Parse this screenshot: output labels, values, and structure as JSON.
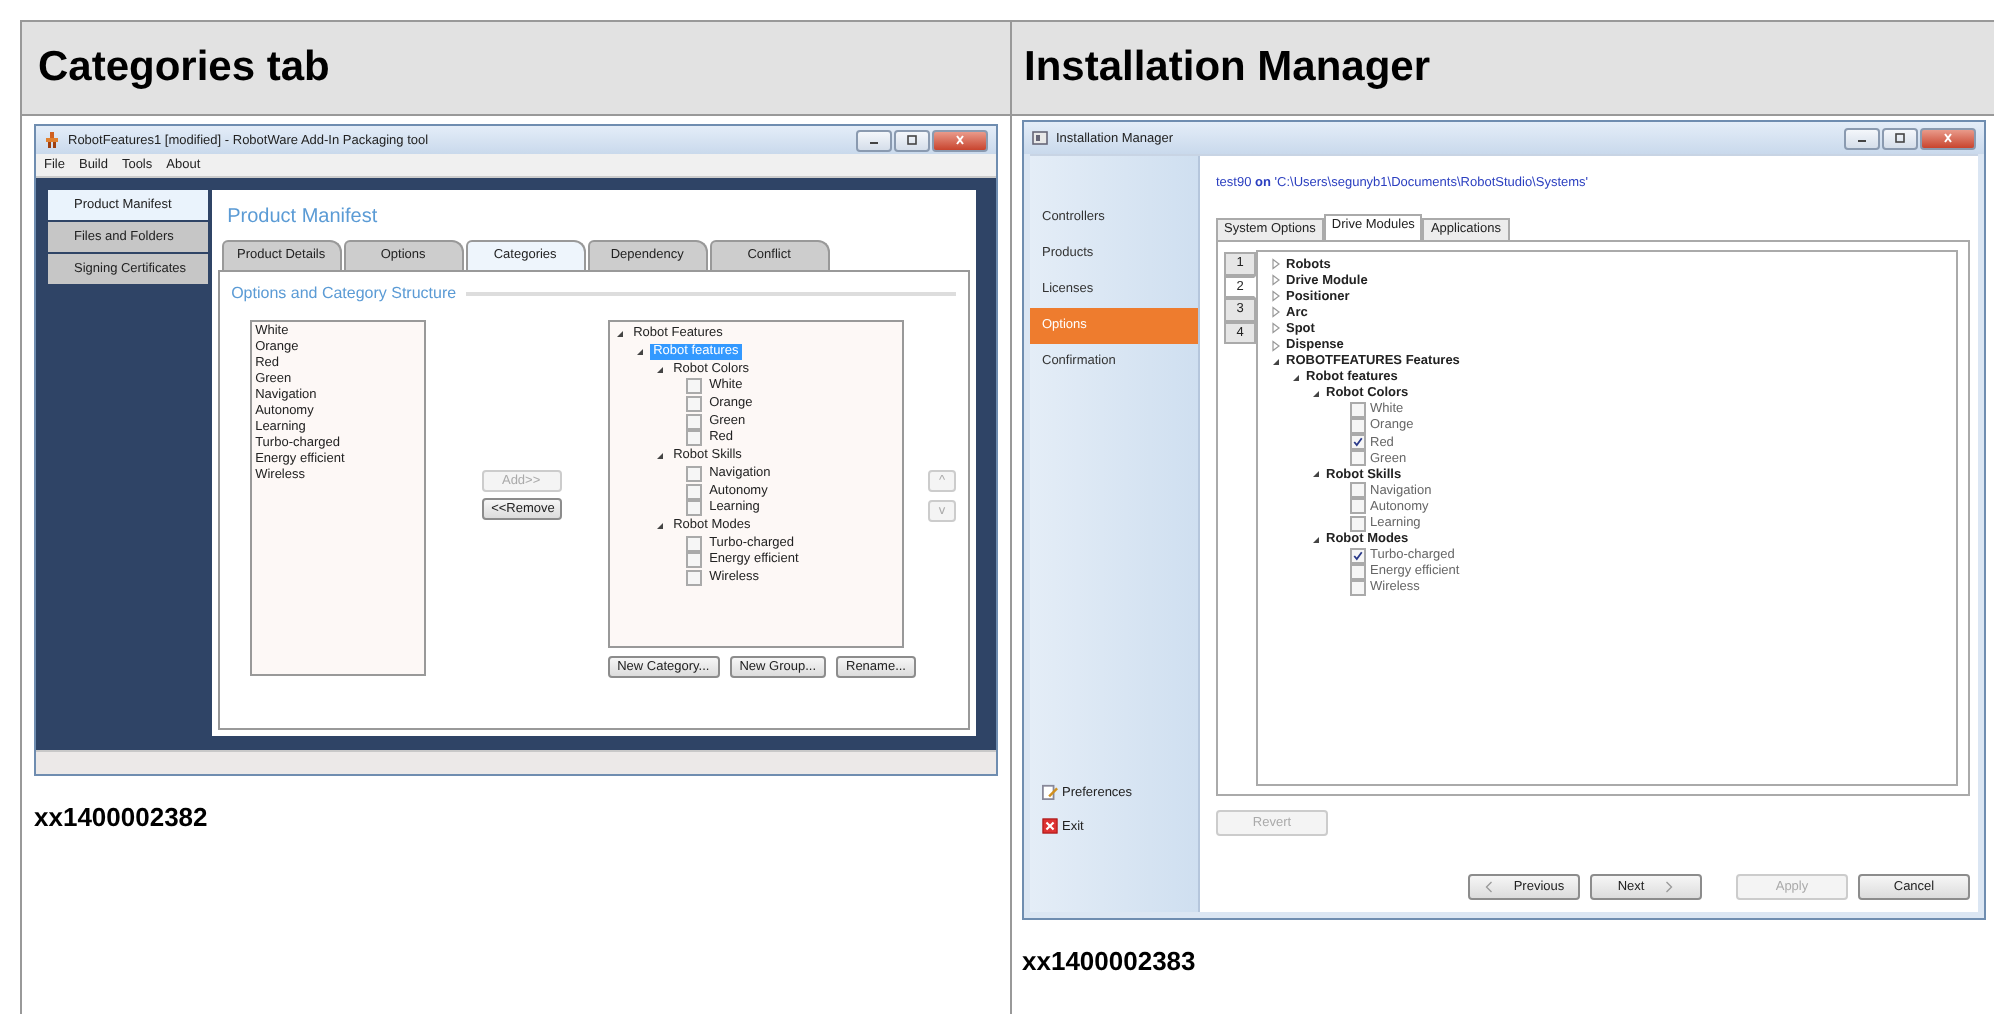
{
  "table": {
    "headers": [
      "Categories tab",
      "Installation Manager"
    ]
  },
  "left": {
    "window_title": "RobotFeatures1 [modified] - RobotWare Add-In Packaging tool",
    "menu": [
      "File",
      "Build",
      "Tools",
      "About"
    ],
    "sidebar": [
      {
        "label": "Product Manifest",
        "selected": true
      },
      {
        "label": "Files and Folders",
        "selected": false
      },
      {
        "label": "Signing Certificates",
        "selected": false
      }
    ],
    "panel_title": "Product Manifest",
    "tabs": [
      {
        "label": "Product Details",
        "selected": false
      },
      {
        "label": "Options",
        "selected": false
      },
      {
        "label": "Categories",
        "selected": true
      },
      {
        "label": "Dependency",
        "selected": false
      },
      {
        "label": "Conflict",
        "selected": false
      }
    ],
    "section_title": "Options and Category Structure",
    "options": [
      "White",
      "Orange",
      "Red",
      "Green",
      "Navigation",
      "Autonomy",
      "Learning",
      "Turbo-charged",
      "Energy efficient",
      "Wireless"
    ],
    "move_buttons": [
      {
        "label": "Add>>",
        "disabled": true
      },
      {
        "label": "<<Remove",
        "disabled": false
      }
    ],
    "tree": [
      {
        "kind": "group",
        "label": "Robot Features",
        "selected": false,
        "expanded": true,
        "children": [
          {
            "kind": "group",
            "label": "Robot features",
            "selected": true,
            "expanded": true,
            "children": [
              {
                "kind": "group",
                "label": "Robot Colors",
                "selected": false,
                "expanded": true,
                "children": [
                  {
                    "kind": "option",
                    "label": "White",
                    "selected": false,
                    "checked": false
                  },
                  {
                    "kind": "option",
                    "label": "Orange",
                    "selected": false,
                    "checked": false
                  },
                  {
                    "kind": "option",
                    "label": "Green",
                    "selected": false,
                    "checked": false
                  },
                  {
                    "kind": "option",
                    "label": "Red",
                    "selected": false,
                    "checked": false
                  }
                ]
              },
              {
                "kind": "group",
                "label": "Robot Skills",
                "selected": false,
                "expanded": true,
                "children": [
                  {
                    "kind": "option",
                    "label": "Navigation",
                    "selected": false,
                    "checked": false
                  },
                  {
                    "kind": "option",
                    "label": "Autonomy",
                    "selected": false,
                    "checked": false
                  },
                  {
                    "kind": "option",
                    "label": "Learning",
                    "selected": false,
                    "checked": false
                  }
                ]
              },
              {
                "kind": "group",
                "label": "Robot Modes",
                "selected": false,
                "expanded": true,
                "children": [
                  {
                    "kind": "option",
                    "label": "Turbo-charged",
                    "selected": false,
                    "checked": false
                  },
                  {
                    "kind": "option",
                    "label": "Energy efficient",
                    "selected": false,
                    "checked": false
                  },
                  {
                    "kind": "option",
                    "label": "Wireless",
                    "selected": false,
                    "checked": false
                  }
                ]
              }
            ]
          }
        ]
      }
    ],
    "tree_buttons": [
      "New Category...",
      "New Group...",
      "Rename..."
    ],
    "order_buttons": [
      {
        "label": "^",
        "disabled": true
      },
      {
        "label": "v",
        "disabled": true
      }
    ],
    "caption": "xx1400002382"
  },
  "right": {
    "window_title": "Installation Manager",
    "nav": [
      {
        "label": "Controllers",
        "selected": false
      },
      {
        "label": "Products",
        "selected": false
      },
      {
        "label": "Licenses",
        "selected": false
      },
      {
        "label": "Options",
        "selected": true
      },
      {
        "label": "Confirmation",
        "selected": false
      }
    ],
    "nav_bottom": [
      {
        "kind": "preferences",
        "label": "Preferences"
      },
      {
        "kind": "exit",
        "label": "Exit"
      }
    ],
    "system_path": "test90 **on** 'C:\\Users\\segunyb1\\Documents\\RobotStudio\\Systems'",
    "tabs": [
      {
        "label": "System Options",
        "selected": false
      },
      {
        "label": "Drive Modules",
        "selected": true
      },
      {
        "label": "Applications",
        "selected": false
      }
    ],
    "module_tabs": [
      {
        "label": "1",
        "selected": false
      },
      {
        "label": "2",
        "selected": true
      },
      {
        "label": "3",
        "selected": false
      },
      {
        "label": "4",
        "selected": false
      }
    ],
    "tree": [
      {
        "kind": "group",
        "label": "Robots",
        "expanded": false
      },
      {
        "kind": "group",
        "label": "Drive Module",
        "expanded": false
      },
      {
        "kind": "group",
        "label": "Positioner",
        "expanded": false
      },
      {
        "kind": "group",
        "label": "Arc",
        "expanded": false
      },
      {
        "kind": "group",
        "label": "Spot",
        "expanded": false
      },
      {
        "kind": "group",
        "label": "Dispense",
        "expanded": false
      },
      {
        "kind": "group",
        "label": "ROBOTFEATURES Features",
        "expanded": true,
        "children": [
          {
            "kind": "group",
            "label": "Robot features",
            "expanded": true,
            "children": [
              {
                "kind": "group",
                "label": "Robot Colors",
                "expanded": true,
                "children": [
                  {
                    "kind": "option",
                    "label": "White",
                    "checked": false
                  },
                  {
                    "kind": "option",
                    "label": "Orange",
                    "checked": false
                  },
                  {
                    "kind": "option",
                    "label": "Red",
                    "checked": true
                  },
                  {
                    "kind": "option",
                    "label": "Green",
                    "checked": false
                  }
                ]
              },
              {
                "kind": "group",
                "label": "Robot Skills",
                "expanded": true,
                "children": [
                  {
                    "kind": "option",
                    "label": "Navigation",
                    "checked": false
                  },
                  {
                    "kind": "option",
                    "label": "Autonomy",
                    "checked": false
                  },
                  {
                    "kind": "option",
                    "label": "Learning",
                    "checked": false
                  }
                ]
              },
              {
                "kind": "group",
                "label": "Robot Modes",
                "expanded": true,
                "children": [
                  {
                    "kind": "option",
                    "label": "Turbo-charged",
                    "checked": true
                  },
                  {
                    "kind": "option",
                    "label": "Energy efficient",
                    "checked": false
                  },
                  {
                    "kind": "option",
                    "label": "Wireless",
                    "checked": false
                  }
                ]
              }
            ]
          }
        ]
      }
    ],
    "revert": {
      "label": "Revert",
      "disabled": true
    },
    "buttons": [
      {
        "label": "Previous",
        "disabled": false,
        "kind": "back"
      },
      {
        "label": "Next",
        "disabled": false,
        "kind": "forward"
      },
      {
        "label": "Apply",
        "disabled": true,
        "kind": "plain"
      },
      {
        "label": "Cancel",
        "disabled": false,
        "kind": "plain"
      }
    ],
    "caption": "xx1400002383"
  }
}
